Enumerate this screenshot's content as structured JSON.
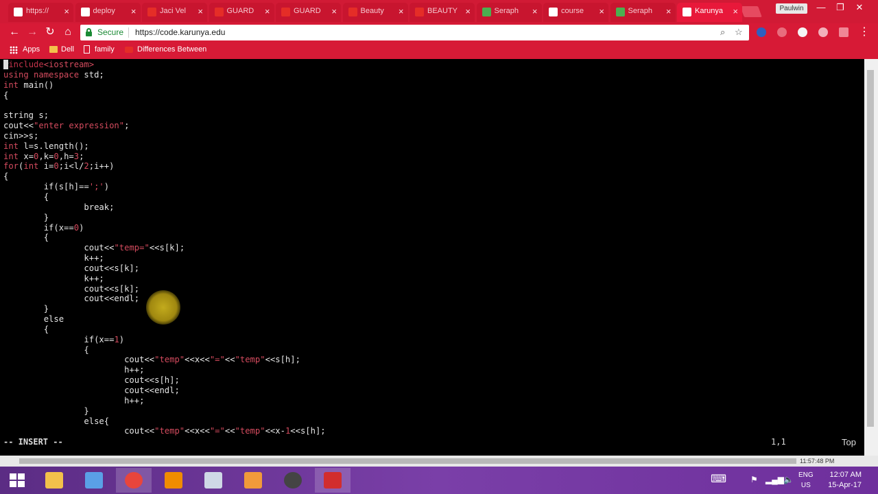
{
  "browser": {
    "tabs": [
      {
        "label": "https://",
        "icon": "page-icon",
        "color": "#ffffff"
      },
      {
        "label": "deploy",
        "icon": "google-icon",
        "color": "#ffffff"
      },
      {
        "label": "Jaci Vel",
        "icon": "youtube-icon",
        "color": "#e52d27"
      },
      {
        "label": "GUARD",
        "icon": "youtube-icon",
        "color": "#e52d27"
      },
      {
        "label": "GUARD",
        "icon": "youtube-icon",
        "color": "#e52d27"
      },
      {
        "label": "Beauty",
        "icon": "youtube-icon",
        "color": "#e52d27"
      },
      {
        "label": "BEAUTY",
        "icon": "youtube-icon",
        "color": "#e52d27"
      },
      {
        "label": "Seraph",
        "icon": "gear-icon",
        "color": "#4caf50"
      },
      {
        "label": "course",
        "icon": "m-icon",
        "color": "#ffffff"
      },
      {
        "label": "Seraph",
        "icon": "gear-icon",
        "color": "#4caf50"
      },
      {
        "label": "Karunya",
        "icon": "terminal-icon",
        "color": "#ffffff"
      }
    ],
    "tab_close": "×",
    "profile_name": "Paulwin",
    "window_controls": {
      "minimize": "—",
      "maximize": "❐",
      "close": "✕"
    },
    "toolbar": {
      "back": "←",
      "forward": "→",
      "reload": "↻",
      "home": "⌂",
      "secure_label": "Secure",
      "url": "https://code.karunya.edu",
      "zoom_icon": "⌕",
      "star_icon": "☆",
      "menu_icon": "⋮"
    },
    "bookmarks": {
      "apps": "Apps",
      "dell": "Dell",
      "family": "family",
      "differences": "Differences Between"
    },
    "accent": "#d71a36"
  },
  "editor": {
    "mode": "-- INSERT --",
    "position": "1,1",
    "scroll": "Top",
    "code_lines": [
      [
        {
          "t": "#"
        },
        {
          "t": "include",
          "c": "pp"
        },
        {
          "t": "<iostream>",
          "c": "str"
        }
      ],
      [
        {
          "t": "using",
          "c": "kw"
        },
        {
          "t": " "
        },
        {
          "t": "namespace",
          "c": "kw"
        },
        {
          "t": " std;"
        }
      ],
      [
        {
          "t": "int",
          "c": "kw"
        },
        {
          "t": " main()"
        }
      ],
      [
        {
          "t": "{"
        }
      ],
      [
        {
          "t": ""
        }
      ],
      [
        {
          "t": "string s;"
        }
      ],
      [
        {
          "t": "cout<<"
        },
        {
          "t": "\"enter expression\"",
          "c": "str"
        },
        {
          "t": ";"
        }
      ],
      [
        {
          "t": "cin>>s;"
        }
      ],
      [
        {
          "t": "int",
          "c": "kw"
        },
        {
          "t": " l=s.length();"
        }
      ],
      [
        {
          "t": "int",
          "c": "kw"
        },
        {
          "t": " x="
        },
        {
          "t": "0",
          "c": "num"
        },
        {
          "t": ",k="
        },
        {
          "t": "0",
          "c": "num"
        },
        {
          "t": ",h="
        },
        {
          "t": "3",
          "c": "num"
        },
        {
          "t": ";"
        }
      ],
      [
        {
          "t": "for",
          "c": "kw"
        },
        {
          "t": "("
        },
        {
          "t": "int",
          "c": "kw"
        },
        {
          "t": " i="
        },
        {
          "t": "0",
          "c": "num"
        },
        {
          "t": ";i<l/"
        },
        {
          "t": "2",
          "c": "num"
        },
        {
          "t": ";i++)"
        }
      ],
      [
        {
          "t": "{"
        }
      ],
      [
        {
          "t": "        if(s[h]=="
        },
        {
          "t": "';'",
          "c": "str"
        },
        {
          "t": ")"
        }
      ],
      [
        {
          "t": "        {"
        }
      ],
      [
        {
          "t": "                break;"
        }
      ],
      [
        {
          "t": "        }"
        }
      ],
      [
        {
          "t": "        if(x=="
        },
        {
          "t": "0",
          "c": "num"
        },
        {
          "t": ")"
        }
      ],
      [
        {
          "t": "        {"
        }
      ],
      [
        {
          "t": "                cout<<"
        },
        {
          "t": "\"temp=\"",
          "c": "str"
        },
        {
          "t": "<<s[k];"
        }
      ],
      [
        {
          "t": "                k++;"
        }
      ],
      [
        {
          "t": "                cout<<s[k];"
        }
      ],
      [
        {
          "t": "                k++;"
        }
      ],
      [
        {
          "t": "                cout<<s[k];"
        }
      ],
      [
        {
          "t": "                cout<<endl;"
        }
      ],
      [
        {
          "t": "        }"
        }
      ],
      [
        {
          "t": "        else"
        }
      ],
      [
        {
          "t": "        {"
        }
      ],
      [
        {
          "t": "                if(x=="
        },
        {
          "t": "1",
          "c": "num"
        },
        {
          "t": ")"
        }
      ],
      [
        {
          "t": "                {"
        }
      ],
      [
        {
          "t": "                        cout<<"
        },
        {
          "t": "\"temp\"",
          "c": "str"
        },
        {
          "t": "<<x<<"
        },
        {
          "t": "\"=\"",
          "c": "str"
        },
        {
          "t": "<<"
        },
        {
          "t": "\"temp\"",
          "c": "str"
        },
        {
          "t": "<<s[h];"
        }
      ],
      [
        {
          "t": "                        h++;"
        }
      ],
      [
        {
          "t": "                        cout<<s[h];"
        }
      ],
      [
        {
          "t": "                        cout<<endl;"
        }
      ],
      [
        {
          "t": "                        h++;"
        }
      ],
      [
        {
          "t": "                }"
        }
      ],
      [
        {
          "t": "                else{"
        }
      ],
      [
        {
          "t": "                        cout<<"
        },
        {
          "t": "\"temp\"",
          "c": "str"
        },
        {
          "t": "<<x<<"
        },
        {
          "t": "\"=\"",
          "c": "str"
        },
        {
          "t": "<<"
        },
        {
          "t": "\"temp\"",
          "c": "str"
        },
        {
          "t": "<<x-"
        },
        {
          "t": "1",
          "c": "num"
        },
        {
          "t": "<<s[h];"
        }
      ]
    ]
  },
  "statusbar": {
    "time": "11:57:48 PM"
  },
  "taskbar": {
    "apps": [
      {
        "name": "file-explorer-icon",
        "color": "#f3c14b"
      },
      {
        "name": "folder-icon",
        "color": "#5aa0e6"
      },
      {
        "name": "chrome-icon",
        "color": "#e8453c"
      },
      {
        "name": "vlc-icon",
        "color": "#f08c00"
      },
      {
        "name": "snipping-tool-icon",
        "color": "#cfd8e6"
      },
      {
        "name": "sublime-text-icon",
        "color": "#f19a3a"
      },
      {
        "name": "media-player-icon",
        "color": "#444444"
      },
      {
        "name": "acrobat-icon",
        "color": "#d22d2d"
      }
    ],
    "lang_top": "ENG",
    "lang_bottom": "US",
    "time": "12:07 AM",
    "date": "15-Apr-17"
  }
}
